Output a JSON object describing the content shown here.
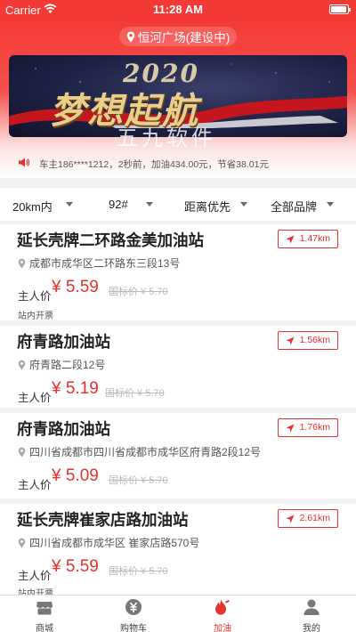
{
  "status_bar": {
    "carrier": "Carrier",
    "time": "11:28 AM"
  },
  "header": {
    "location": "恒河广场(建设中)",
    "banner": {
      "year": "2020",
      "slogan": "梦想起航"
    },
    "watermark": "五九软件"
  },
  "notice": {
    "text": "车主186****1212，2秒前，加油434.00元，节省38.01元"
  },
  "filters": [
    {
      "label": "20km内"
    },
    {
      "label": "92#"
    },
    {
      "label": "距离优先"
    },
    {
      "label": "全部品牌"
    }
  ],
  "stations": [
    {
      "name": "延长壳牌二环路金美加油站",
      "distance": "1.47km",
      "address": "成都市成华区二环路东三段13号",
      "price_label": "主人价",
      "price": "¥ 5.59",
      "std_price": "国标价 ¥ 5.70",
      "tag": "站内开票"
    },
    {
      "name": "府青路加油站",
      "distance": "1.56km",
      "address": "府青路二段12号",
      "price_label": "主人价",
      "price": "¥ 5.19",
      "std_price": "国标价 ¥ 5.70",
      "tag": ""
    },
    {
      "name": "府青路加油站",
      "distance": "1.76km",
      "address": "四川省成都市四川省成都市成华区府青路2段12号",
      "price_label": "主人价",
      "price": "¥ 5.09",
      "std_price": "国标价 ¥ 5.70",
      "tag": ""
    },
    {
      "name": "延长壳牌崔家店路加油站",
      "distance": "2.61km",
      "address": "四川省成都市成华区 崔家店路570号",
      "price_label": "主人价",
      "price": "¥ 5.59",
      "std_price": "国标价 ¥ 5.70",
      "tag": "站内开票"
    }
  ],
  "tabbar": [
    {
      "label": "商城",
      "icon": "store-icon"
    },
    {
      "label": "购物车",
      "icon": "cart-icon"
    },
    {
      "label": "加油",
      "icon": "fuel-icon",
      "active": true
    },
    {
      "label": "我的",
      "icon": "user-icon"
    }
  ],
  "colors": {
    "primary": "#f33a36",
    "accent": "#e4322e"
  }
}
